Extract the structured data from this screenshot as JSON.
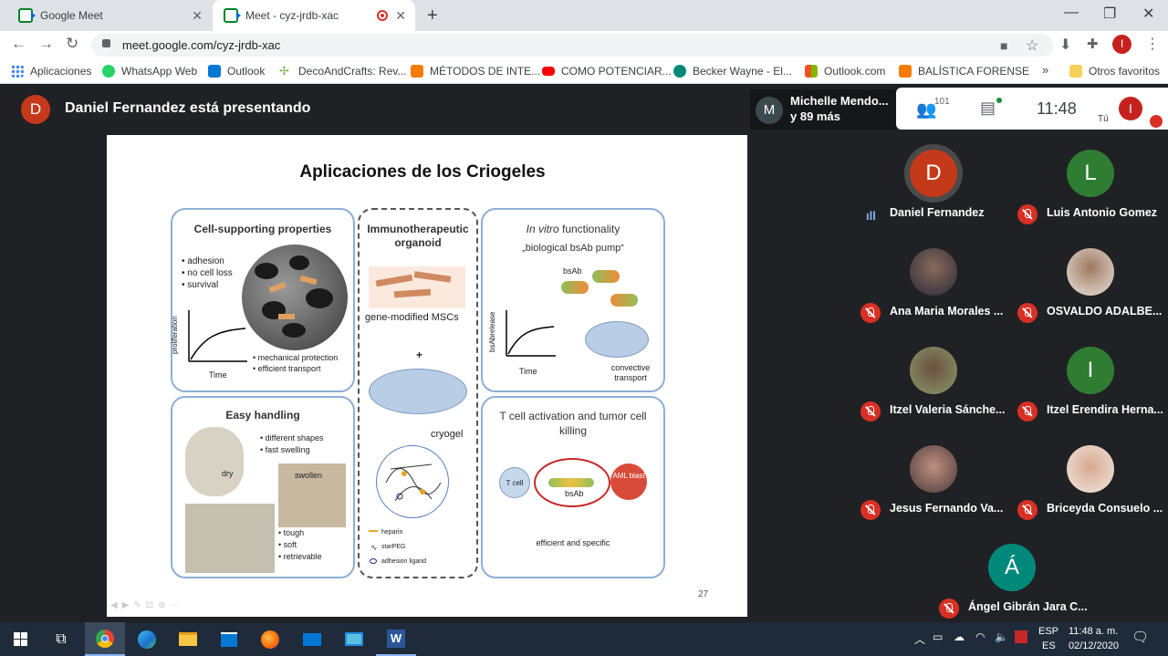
{
  "browser": {
    "tabs": [
      {
        "title": "Google Meet",
        "active": false
      },
      {
        "title": "Meet - cyz-jrdb-xac",
        "active": true
      }
    ],
    "url": "meet.google.com/cyz-jrdb-xac",
    "profile_initial": "I",
    "bookmarks": [
      {
        "label": "Aplicaciones",
        "icon": "apps-grid-icon",
        "color": "#4285f4"
      },
      {
        "label": "WhatsApp Web",
        "icon": "whatsapp-icon",
        "color": "#25d366"
      },
      {
        "label": "Outlook",
        "icon": "outlook-icon",
        "color": "#0078d4"
      },
      {
        "label": "DecoAndCrafts: Rev...",
        "icon": "leaf-icon",
        "color": "#7cb342"
      },
      {
        "label": "MÉTODOS DE INTE...",
        "icon": "blogger-icon",
        "color": "#f57c00"
      },
      {
        "label": "COMO POTENCIAR...",
        "icon": "youtube-icon",
        "color": "#ff0000"
      },
      {
        "label": "Becker Wayne - El...",
        "icon": "globe-icon",
        "color": "#00897b"
      },
      {
        "label": "Outlook.com",
        "icon": "microsoft-icon",
        "color": "#f25022"
      },
      {
        "label": "BALÍSTICA FORENSE",
        "icon": "blogger-icon",
        "color": "#f57c00"
      }
    ],
    "bookmarks_more": "»",
    "other_bookmarks": "Otros favoritos"
  },
  "meet": {
    "presenter_initial": "D",
    "presenter_text": "Daniel Fernandez está presentando",
    "others_name": "Michelle Mendo...",
    "others_count": "y 89 más",
    "others_initial": "M",
    "participants_count": "101",
    "time": "11:48",
    "self_label": "Tú",
    "self_initial": "I",
    "participants": [
      {
        "name": "Daniel Fernandez",
        "initial": "D",
        "color": "#c5391b",
        "speaking": true,
        "photo": false
      },
      {
        "name": "Luis Antonio Gomez",
        "initial": "L",
        "color": "#2e7d32",
        "speaking": false,
        "photo": false
      },
      {
        "name": "Ana Maria Morales ...",
        "initial": "",
        "color": "#5a4a3a",
        "speaking": false,
        "photo": true
      },
      {
        "name": "OSVALDO ADALBE...",
        "initial": "",
        "color": "#c8c0b4",
        "speaking": false,
        "photo": true
      },
      {
        "name": "Itzel Valeria Sánche...",
        "initial": "",
        "color": "#6b7a4a",
        "speaking": false,
        "photo": true
      },
      {
        "name": "Itzel Erendira Herna...",
        "initial": "I",
        "color": "#2e7d32",
        "speaking": false,
        "photo": false
      },
      {
        "name": "Jesus Fernando Va...",
        "initial": "",
        "color": "#7a6a5a",
        "speaking": false,
        "photo": true
      },
      {
        "name": "Briceyda Consuelo ...",
        "initial": "",
        "color": "#d8c8b8",
        "speaking": false,
        "photo": true
      },
      {
        "name": "Ángel Gibrán Jara C...",
        "initial": "Á",
        "color": "#00897b",
        "speaking": false,
        "photo": false
      }
    ]
  },
  "slide": {
    "title": "Aplicaciones de los Criogeles",
    "page_number": "27",
    "panels": {
      "cell_supporting": {
        "title": "Cell-supporting properties",
        "bullets": [
          "adhesion",
          "no cell loss",
          "survival"
        ],
        "ylabel": "proliferation",
        "xlabel": "Time",
        "bullets2": [
          "mechanical protection",
          "efficient transport"
        ]
      },
      "immuno": {
        "title": "Immunotherapeutic organoid",
        "msc_label": "gene-modified MSCs",
        "plus": "+",
        "cryogel_label": "cryogel",
        "legend": [
          "heparin",
          "starPEG",
          "adhesion ligand"
        ]
      },
      "invitro": {
        "title_italic": "In vitro",
        "title_rest": " functionality",
        "subtitle": "„biological bsAb pump“",
        "bsab": "bsAb",
        "ylabel": "bsAbrelease",
        "xlabel": "Time",
        "convective": "convective transport"
      },
      "handling": {
        "title": "Easy handling",
        "bullets": [
          "different shapes",
          "fast swelling"
        ],
        "dry": "dry",
        "swollen": "swollen",
        "bullets2": [
          "tough",
          "soft",
          "retrievable"
        ]
      },
      "tcell": {
        "title": "T cell activation and tumor cell killing",
        "tcell": "T cell",
        "aml": "AML blast",
        "bsab": "bsAb",
        "footer": "efficient and specific"
      }
    }
  },
  "taskbar": {
    "lang1": "ESP",
    "lang2": "ES",
    "time": "11:48 a. m.",
    "date": "02/12/2020"
  }
}
